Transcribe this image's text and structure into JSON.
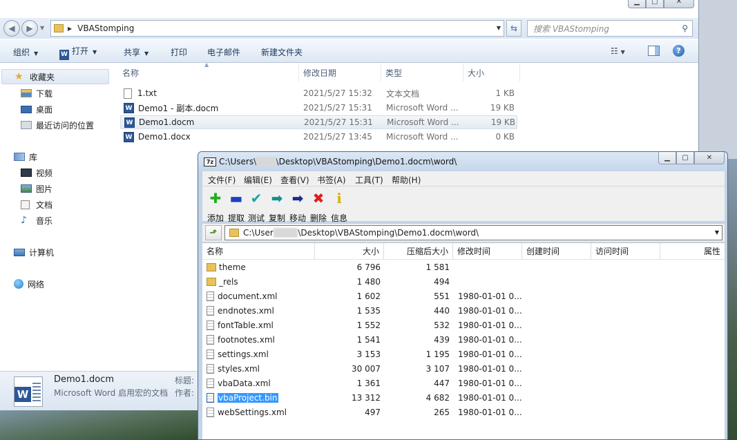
{
  "explorer": {
    "address": {
      "crumb": "VBAStomping"
    },
    "search_placeholder": "搜索 VBAStomping",
    "toolbar": {
      "organize": "组织",
      "open": "打开",
      "share": "共享",
      "print": "打印",
      "email": "电子邮件",
      "new_folder": "新建文件夹"
    },
    "nav": {
      "favorites": "收藏夹",
      "downloads": "下载",
      "desktop": "桌面",
      "recent": "最近访问的位置",
      "libraries": "库",
      "videos": "视频",
      "pictures": "图片",
      "documents": "文档",
      "music": "音乐",
      "computer": "计算机",
      "network": "网络"
    },
    "columns": {
      "name": "名称",
      "modified": "修改日期",
      "type": "类型",
      "size": "大小"
    },
    "files": [
      {
        "name": "1.txt",
        "date": "2021/5/27 15:32",
        "type": "文本文档",
        "size": "1 KB",
        "icon": "text-file-icon"
      },
      {
        "name": "Demo1 - 副本.docm",
        "date": "2021/5/27 15:31",
        "type": "Microsoft Word ...",
        "size": "19 KB",
        "icon": "word-doc-icon"
      },
      {
        "name": "Demo1.docm",
        "date": "2021/5/27 15:31",
        "type": "Microsoft Word ...",
        "size": "19 KB",
        "icon": "word-doc-icon"
      },
      {
        "name": "Demo1.docx",
        "date": "2021/5/27 13:45",
        "type": "Microsoft Word ...",
        "size": "0 KB",
        "icon": "word-doc-icon"
      }
    ],
    "details": {
      "name": "Demo1.docm",
      "type": "Microsoft Word 启用宏的文档",
      "label_title": "标题:",
      "label_author": "作者:"
    }
  },
  "zip": {
    "title_prefix": "C:\\Users\\",
    "title_suffix": "\\Desktop\\VBAStomping\\Demo1.docm\\word\\",
    "menu": {
      "file": "文件(F)",
      "edit": "编辑(E)",
      "view": "查看(V)",
      "bookmarks": "书签(A)",
      "tools": "工具(T)",
      "help": "帮助(H)"
    },
    "tools": {
      "add": "添加",
      "extract": "提取",
      "test": "测试",
      "copy": "复制",
      "move": "移动",
      "delete": "删除",
      "info": "信息"
    },
    "path_prefix": "C:\\User",
    "path_suffix": "\\Desktop\\VBAStomping\\Demo1.docm\\word\\",
    "columns": {
      "name": "名称",
      "size": "大小",
      "packed": "压缩后大小",
      "modified": "修改时间",
      "created": "创建时间",
      "accessed": "访问时间",
      "attributes": "属性"
    },
    "rows": [
      {
        "name": "theme",
        "size": "6 796",
        "packed": "1 581",
        "modified": "",
        "kind": "folder"
      },
      {
        "name": "_rels",
        "size": "1 480",
        "packed": "494",
        "modified": "",
        "kind": "folder"
      },
      {
        "name": "document.xml",
        "size": "1 602",
        "packed": "551",
        "modified": "1980-01-01 0...",
        "kind": "file"
      },
      {
        "name": "endnotes.xml",
        "size": "1 535",
        "packed": "440",
        "modified": "1980-01-01 0...",
        "kind": "file"
      },
      {
        "name": "fontTable.xml",
        "size": "1 552",
        "packed": "532",
        "modified": "1980-01-01 0...",
        "kind": "file"
      },
      {
        "name": "footnotes.xml",
        "size": "1 541",
        "packed": "439",
        "modified": "1980-01-01 0...",
        "kind": "file"
      },
      {
        "name": "settings.xml",
        "size": "3 153",
        "packed": "1 195",
        "modified": "1980-01-01 0...",
        "kind": "file"
      },
      {
        "name": "styles.xml",
        "size": "30 007",
        "packed": "3 107",
        "modified": "1980-01-01 0...",
        "kind": "file"
      },
      {
        "name": "vbaData.xml",
        "size": "1 361",
        "packed": "447",
        "modified": "1980-01-01 0...",
        "kind": "file"
      },
      {
        "name": "vbaProject.bin",
        "size": "13 312",
        "packed": "4 682",
        "modified": "1980-01-01 0...",
        "kind": "file"
      },
      {
        "name": "webSettings.xml",
        "size": "497",
        "packed": "265",
        "modified": "1980-01-01 0...",
        "kind": "file"
      }
    ]
  },
  "colors": {
    "accent": "#3399ff",
    "word_blue": "#2b5797",
    "folder": "#e8c25a"
  }
}
